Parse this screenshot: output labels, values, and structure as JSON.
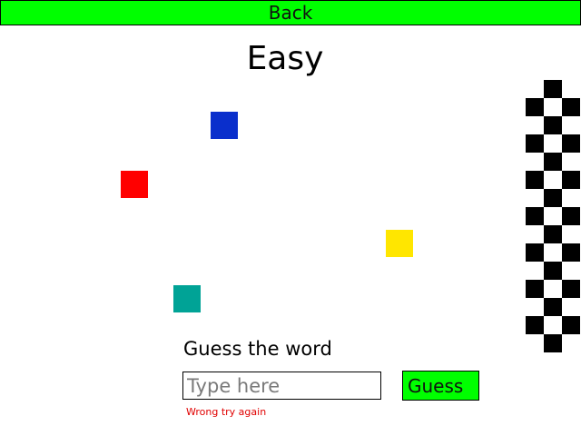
{
  "header": {
    "back_label": "Back"
  },
  "level": {
    "title": "Easy"
  },
  "blocks": [
    {
      "name": "blue-block",
      "color": "#0a2fcc"
    },
    {
      "name": "red-block",
      "color": "#ff0000"
    },
    {
      "name": "yellow-block",
      "color": "#ffe600"
    },
    {
      "name": "teal-block",
      "color": "#00a396"
    }
  ],
  "finish_flag": {
    "pattern": "checkered",
    "colors": [
      "#000000",
      "#ffffff"
    ]
  },
  "guess": {
    "prompt": "Guess the word",
    "placeholder": "Type here",
    "value": "",
    "button_label": "Guess",
    "error": "Wrong try again"
  }
}
